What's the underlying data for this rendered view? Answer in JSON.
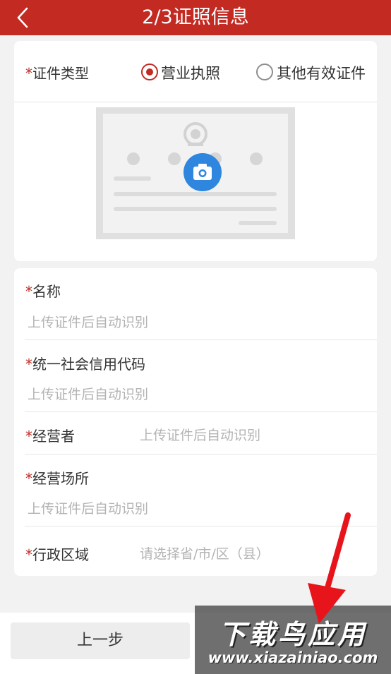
{
  "header": {
    "title": "2/3证照信息",
    "bg_color": "#c22a22",
    "back_icon": "chevron-left-icon"
  },
  "required_mark": "*",
  "cert_type": {
    "label": "证件类型",
    "options": [
      {
        "label": "营业执照",
        "selected": true
      },
      {
        "label": "其他有效证件",
        "selected": false
      }
    ]
  },
  "upload": {
    "icon": "camera-icon",
    "icon_color": "#2f86de"
  },
  "fields": {
    "name": {
      "label": "名称",
      "placeholder": "上传证件后自动识别"
    },
    "credit_code": {
      "label": "统一社会信用代码",
      "placeholder": "上传证件后自动识别"
    },
    "operator": {
      "label": "经营者",
      "placeholder": "上传证件后自动识别"
    },
    "premises": {
      "label": "经营场所",
      "placeholder": "上传证件后自动识别"
    },
    "region": {
      "label": "行政区域",
      "placeholder": "请选择省/市/区（县）"
    }
  },
  "footer": {
    "prev_label": "上一步"
  },
  "watermark": {
    "text": "下载鸟应用",
    "url": "www.xiazainiao.com"
  }
}
